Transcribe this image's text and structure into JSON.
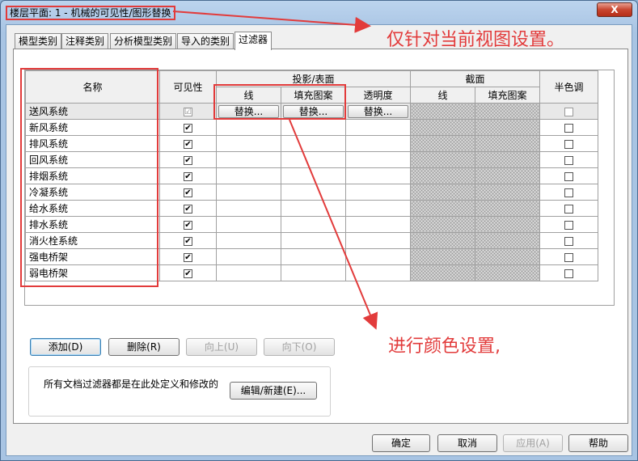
{
  "window": {
    "title": "楼层平面: 1 - 机械的可见性/图形替换",
    "close_label": "X"
  },
  "tabs": [
    {
      "label": "模型类别"
    },
    {
      "label": "注释类别"
    },
    {
      "label": "分析模型类别"
    },
    {
      "label": "导入的类别"
    },
    {
      "label": "过滤器"
    }
  ],
  "grid": {
    "headers": {
      "name": "名称",
      "visibility": "可见性",
      "projection_surface": "投影/表面",
      "line": "线",
      "fill_pattern": "填充图案",
      "transparency": "透明度",
      "cut": "截面",
      "cut_line": "线",
      "cut_fill_pattern": "填充图案",
      "halftone": "半色调"
    },
    "override_label": "替换...",
    "rows": [
      {
        "name": "送风系统",
        "visible": "☑"
      },
      {
        "name": "新风系统",
        "visible": "✔"
      },
      {
        "name": "排风系统",
        "visible": "✔"
      },
      {
        "name": "回风系统",
        "visible": "✔"
      },
      {
        "name": "排烟系统",
        "visible": "✔"
      },
      {
        "name": "冷凝系统",
        "visible": "✔"
      },
      {
        "name": "给水系统",
        "visible": "✔"
      },
      {
        "name": "排水系统",
        "visible": "✔"
      },
      {
        "name": "消火栓系统",
        "visible": "✔"
      },
      {
        "name": "强电桥架",
        "visible": "✔"
      },
      {
        "name": "弱电桥架",
        "visible": "✔"
      }
    ]
  },
  "buttons": {
    "add": "添加(D)",
    "delete": "删除(R)",
    "up": "向上(U)",
    "down": "向下(O)",
    "edit_new": "编辑/新建(E)...",
    "ok": "确定",
    "cancel": "取消",
    "apply": "应用(A)",
    "help": "帮助"
  },
  "info_text": "所有文档过滤器都是在此处定义和修改的",
  "annotations": {
    "top": "仅针对当前视图设置。",
    "middle": "进行颜色设置,"
  },
  "colors": {
    "annotation_red": "#e23b3b",
    "title_bar": "#a8c4e3",
    "hatch": "#9a9a9a"
  }
}
